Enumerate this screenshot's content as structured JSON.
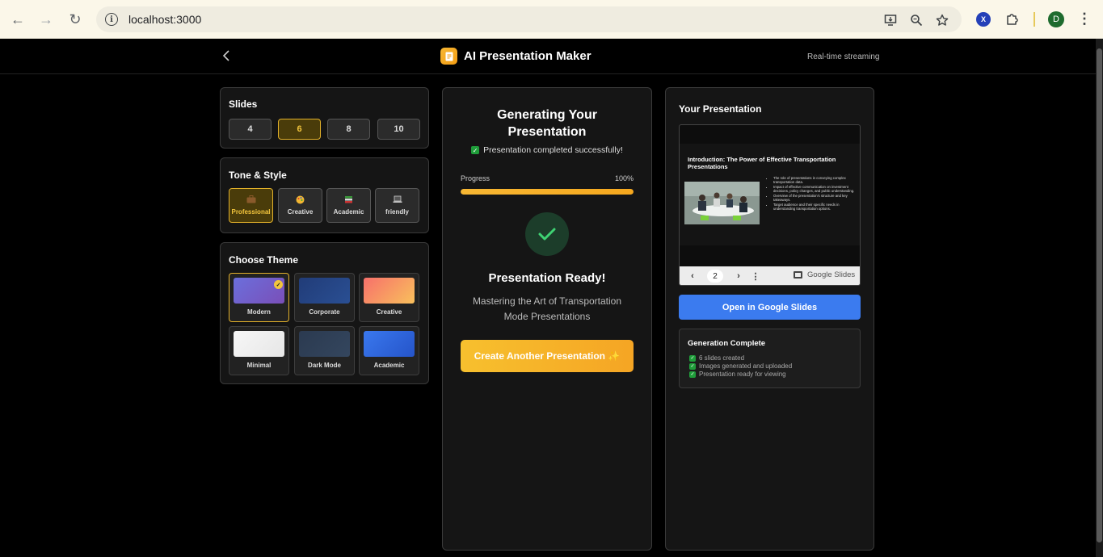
{
  "browser": {
    "url": "localhost:3000",
    "profile_initial": "D",
    "extension_badge": "X"
  },
  "header": {
    "title": "AI Presentation Maker",
    "status": "Real-time streaming"
  },
  "slides_panel": {
    "title": "Slides",
    "options": [
      "4",
      "6",
      "8",
      "10"
    ],
    "selected": "6"
  },
  "tone_panel": {
    "title": "Tone & Style",
    "options": [
      {
        "label": "Professional",
        "icon": "briefcase-icon"
      },
      {
        "label": "Creative",
        "icon": "palette-icon"
      },
      {
        "label": "Academic",
        "icon": "books-icon"
      },
      {
        "label": "friendly",
        "icon": "laptop-icon"
      }
    ],
    "selected": "Professional"
  },
  "theme_panel": {
    "title": "Choose Theme",
    "themes": [
      {
        "name": "Modern",
        "colors": [
          "#6b6fdc",
          "#7a4fb8"
        ]
      },
      {
        "name": "Corporate",
        "colors": [
          "#213c78",
          "#2a4f93"
        ]
      },
      {
        "name": "Creative",
        "colors": [
          "#f7706b",
          "#f9c05c"
        ]
      },
      {
        "name": "Minimal",
        "colors": [
          "#f2f2f2",
          "#e6e6e6"
        ]
      },
      {
        "name": "Dark Mode",
        "colors": [
          "#2b3a50",
          "#34465e"
        ]
      },
      {
        "name": "Academic",
        "colors": [
          "#3370e6",
          "#2554c9"
        ]
      }
    ],
    "selected": "Modern"
  },
  "generation": {
    "title": "Generating Your Presentation",
    "status": "Presentation completed successfully!",
    "progress_label": "Progress",
    "progress_text": "100%",
    "progress": 1.0,
    "ready_title": "Presentation Ready!",
    "ready_subtitle": "Mastering the Art of Transportation Mode Presentations",
    "cta_label": "Create Another Presentation ✨"
  },
  "preview": {
    "title": "Your Presentation",
    "slide_title": "Introduction: The Power of Effective Transportation Presentations",
    "bullets": [
      "The role of presentations in conveying complex transportation data.",
      "Impact of effective communication on investment decisions, policy changes, and public understanding.",
      "Overview of the presentation's structure and key takeaways.",
      "Target audience and their specific needs in understanding transportation options."
    ],
    "page": "2",
    "viewer_label": "Google Slides",
    "open_button": "Open in Google Slides"
  },
  "completion": {
    "title": "Generation Complete",
    "items": [
      "6 slides created",
      "Images generated and uploaded",
      "Presentation ready for viewing"
    ]
  },
  "colors": {
    "accent": "#f2c53d",
    "primary_blue": "#3b7bef",
    "success": "#1f9d3a"
  }
}
